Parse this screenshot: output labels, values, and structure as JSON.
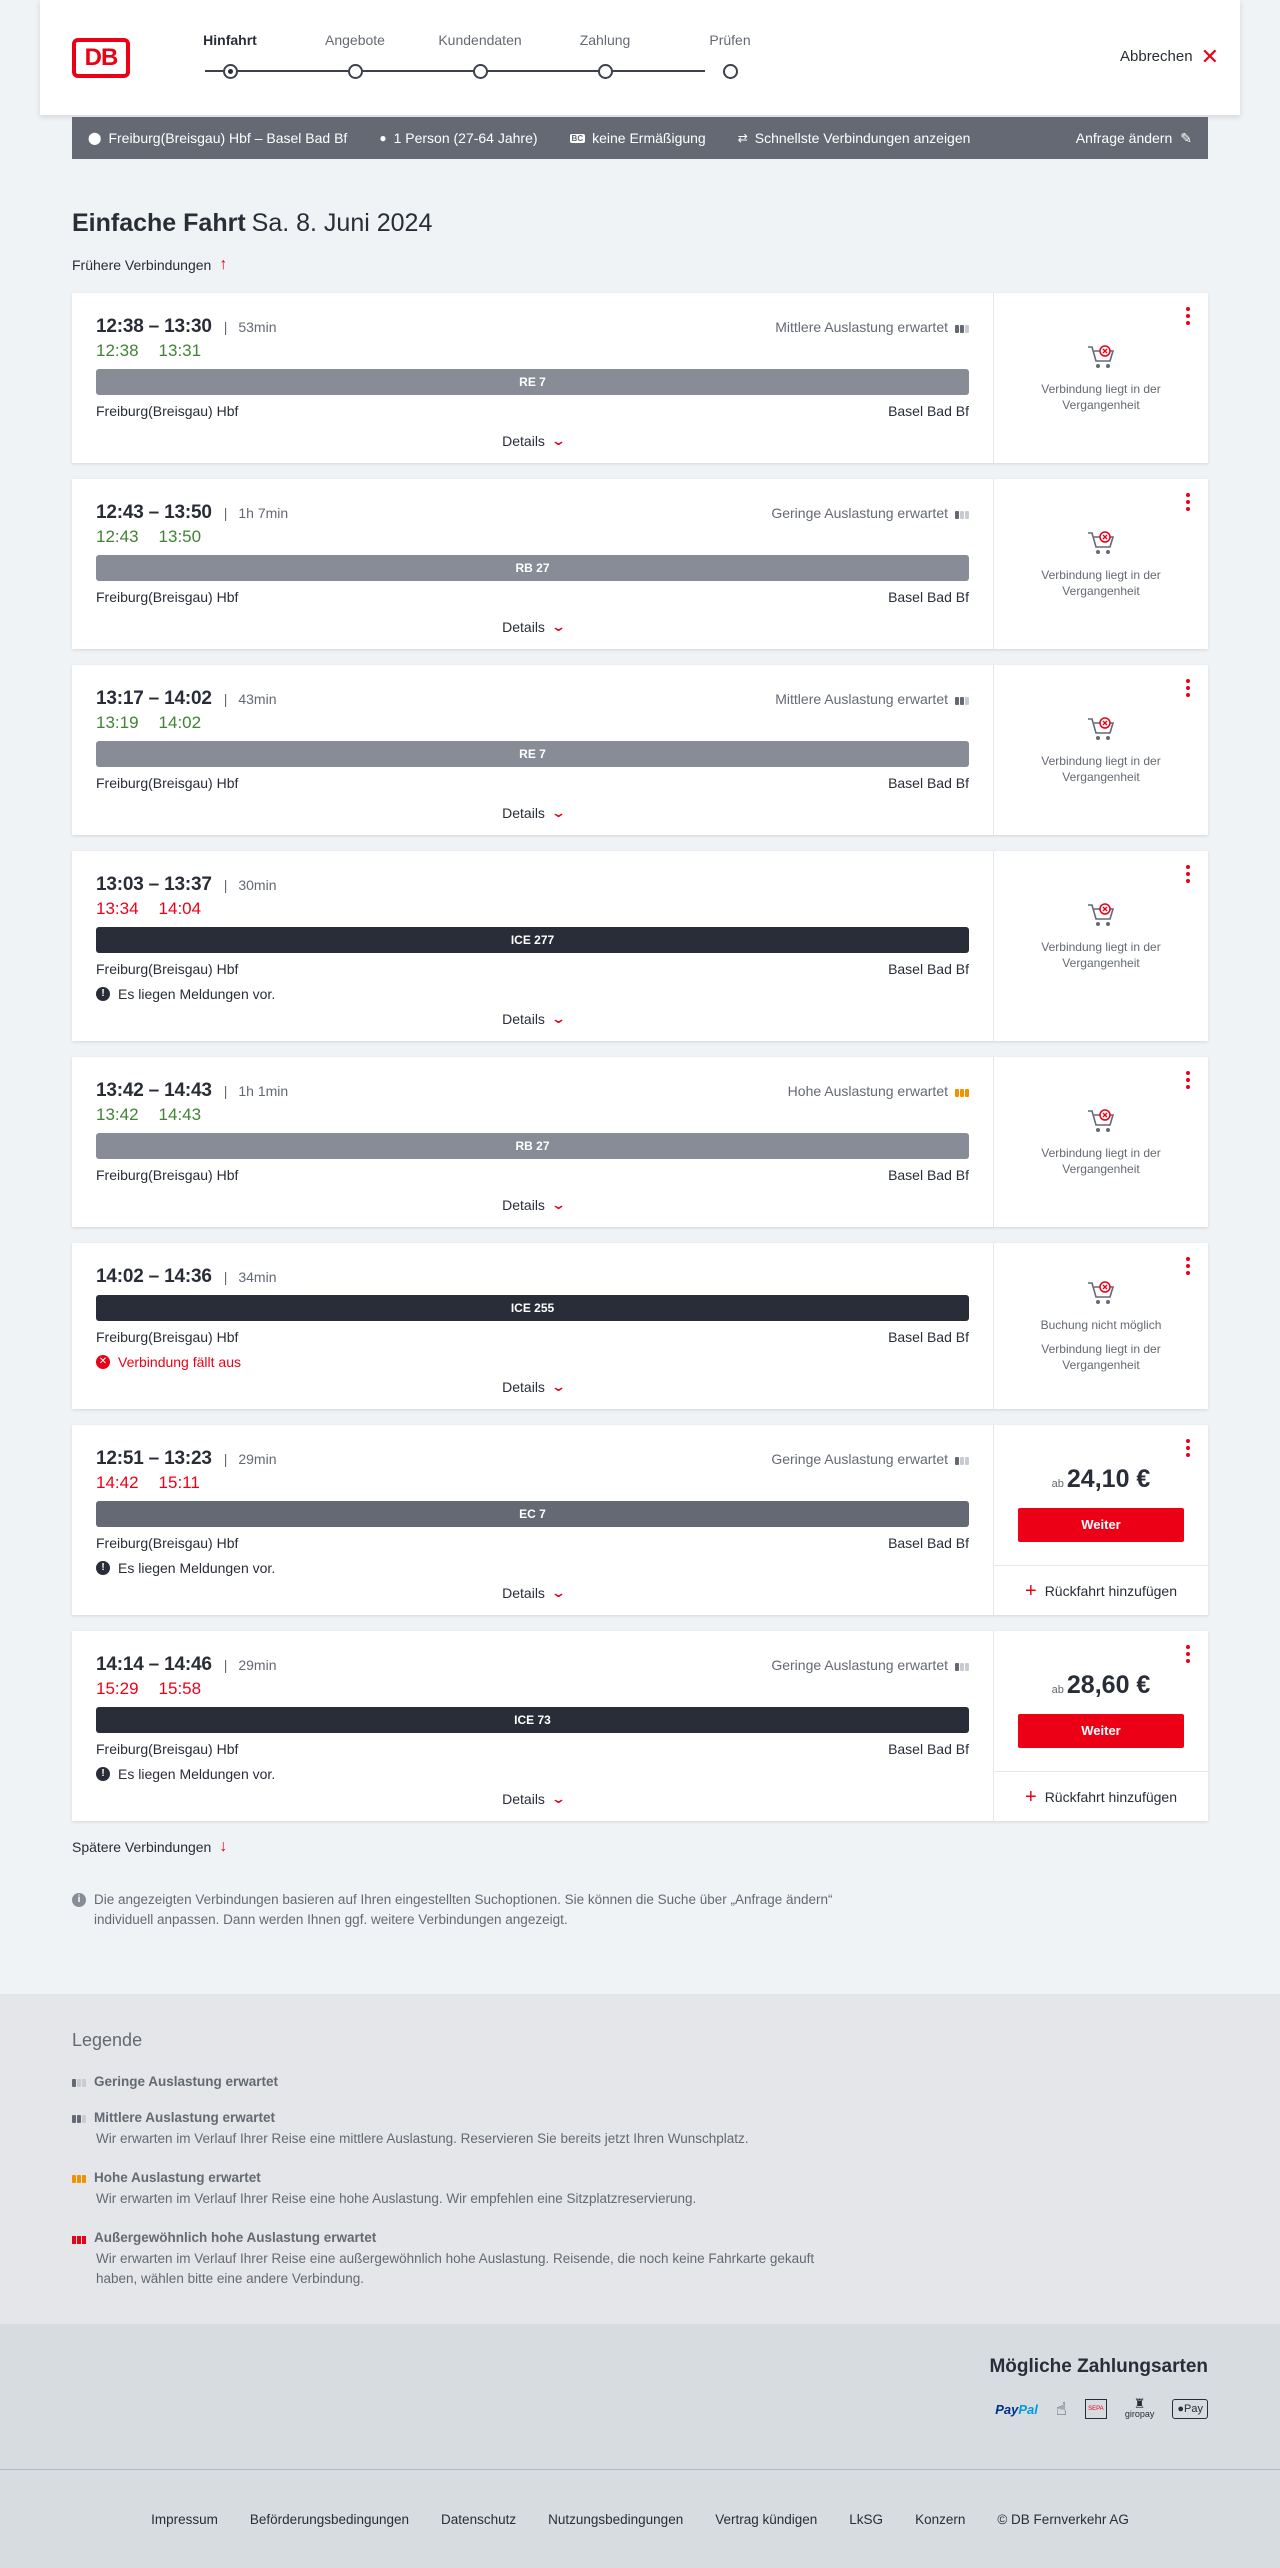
{
  "header": {
    "logo": "DB",
    "steps": [
      {
        "label": "Hinfahrt",
        "active": true
      },
      {
        "label": "Angebote",
        "active": false
      },
      {
        "label": "Kundendaten",
        "active": false
      },
      {
        "label": "Zahlung",
        "active": false
      },
      {
        "label": "Prüfen",
        "active": false
      }
    ],
    "cancel_label": "Abbrechen"
  },
  "search": {
    "route": "Freiburg(Breisgau) Hbf – Basel Bad Bf",
    "passengers": "1 Person (27-64 Jahre)",
    "discount": "keine Ermäßigung",
    "fastest": "Schnellste Verbindungen anzeigen",
    "change": "Anfrage ändern",
    "discount_icon_text": "BC"
  },
  "title": {
    "main": "Einfache Fahrt",
    "date": "Sa. 8. Juni 2024"
  },
  "earlier": "Frühere Verbindungen",
  "later": "Spätere Verbindungen",
  "details_label": "Details",
  "connections": [
    {
      "time": "12:38 – 13:30",
      "duration": "53min",
      "load": "Mittlere Auslastung erwartet",
      "load_level": 2,
      "rt_dep": "12:38",
      "rt_arr": "13:31",
      "rt_color": "green",
      "train": "RE 7",
      "train_kind": "regional",
      "from": "Freiburg(Breisgau) Hbf",
      "to": "Basel Bad Bf",
      "note": "",
      "side": [
        "Verbindung liegt in der Vergangenheit"
      ]
    },
    {
      "time": "12:43 – 13:50",
      "duration": "1h 7min",
      "load": "Geringe Auslastung erwartet",
      "load_level": 1,
      "rt_dep": "12:43",
      "rt_arr": "13:50",
      "rt_color": "green",
      "train": "RB 27",
      "train_kind": "regional",
      "from": "Freiburg(Breisgau) Hbf",
      "to": "Basel Bad Bf",
      "note": "",
      "side": [
        "Verbindung liegt in der Vergangenheit"
      ]
    },
    {
      "time": "13:17 – 14:02",
      "duration": "43min",
      "load": "Mittlere Auslastung erwartet",
      "load_level": 2,
      "rt_dep": "13:19",
      "rt_arr": "14:02",
      "rt_color": "green",
      "train": "RE 7",
      "train_kind": "regional",
      "from": "Freiburg(Breisgau) Hbf",
      "to": "Basel Bad Bf",
      "note": "",
      "side": [
        "Verbindung liegt in der Vergangenheit"
      ]
    },
    {
      "time": "13:03 – 13:37",
      "duration": "30min",
      "load": "",
      "load_level": 0,
      "rt_dep": "13:34",
      "rt_arr": "14:04",
      "rt_color": "red",
      "train": "ICE 277",
      "train_kind": "ic",
      "from": "Freiburg(Breisgau) Hbf",
      "to": "Basel Bad Bf",
      "note": "Es liegen Meldungen vor.",
      "side": [
        "Verbindung liegt in der Vergangenheit"
      ]
    },
    {
      "time": "13:42 – 14:43",
      "duration": "1h 1min",
      "load": "Hohe Auslastung erwartet",
      "load_level": 3,
      "rt_dep": "13:42",
      "rt_arr": "14:43",
      "rt_color": "green",
      "train": "RB 27",
      "train_kind": "regional",
      "from": "Freiburg(Breisgau) Hbf",
      "to": "Basel Bad Bf",
      "note": "",
      "side": [
        "Verbindung liegt in der Vergangenheit"
      ]
    },
    {
      "time": "14:02 – 14:36",
      "duration": "34min",
      "load": "",
      "load_level": 0,
      "rt_dep": "",
      "rt_arr": "",
      "rt_color": "",
      "train": "ICE 255",
      "train_kind": "ic",
      "from": "Freiburg(Breisgau) Hbf",
      "to": "Basel Bad Bf",
      "note": "Verbindung fällt aus",
      "note_kind": "cancel",
      "side": [
        "Buchung nicht möglich",
        "Verbindung liegt in der Vergangenheit"
      ]
    },
    {
      "time": "12:51 – 13:23",
      "duration": "29min",
      "load": "Geringe Auslastung erwartet",
      "load_level": 1,
      "rt_dep": "14:42",
      "rt_arr": "15:11",
      "rt_color": "red",
      "train": "EC 7",
      "train_kind": "ec",
      "from": "Freiburg(Breisgau) Hbf",
      "to": "Basel Bad Bf",
      "note": "Es liegen Meldungen vor.",
      "price_prefix": "ab",
      "price": "24,10 €",
      "button": "Weiter",
      "return": "Rückfahrt hinzufügen"
    },
    {
      "time": "14:14 – 14:46",
      "duration": "29min",
      "load": "Geringe Auslastung erwartet",
      "load_level": 1,
      "rt_dep": "15:29",
      "rt_arr": "15:58",
      "rt_color": "red",
      "train": "ICE 73",
      "train_kind": "ic",
      "from": "Freiburg(Breisgau) Hbf",
      "to": "Basel Bad Bf",
      "note": "Es liegen Meldungen vor.",
      "price_prefix": "ab",
      "price": "28,60 €",
      "button": "Weiter",
      "return": "Rückfahrt hinzufügen"
    }
  ],
  "info": "Die angezeigten Verbindungen basieren auf Ihren eingestellten Suchoptionen. Sie können die Suche über „Anfrage ändern“ individuell anpassen. Dann werden Ihnen ggf. weitere Verbindungen angezeigt.",
  "legend": {
    "title": "Legende",
    "items": [
      {
        "head": "Geringe Auslastung erwartet",
        "desc": ""
      },
      {
        "head": "Mittlere Auslastung erwartet",
        "desc": "Wir erwarten im Verlauf Ihrer Reise eine mittlere Auslastung. Reservieren Sie bereits jetzt Ihren Wunschplatz."
      },
      {
        "head": "Hohe Auslastung erwartet",
        "desc": "Wir erwarten im Verlauf Ihrer Reise eine hohe Auslastung. Wir empfehlen eine Sitzplatzreservierung."
      },
      {
        "head": "Außergewöhnlich hohe Auslastung erwartet",
        "desc": "Wir erwarten im Verlauf Ihrer Reise eine außergewöhnlich hohe Auslastung. Reisende, die noch keine Fahrkarte gekauft haben, wählen bitte eine andere Verbindung."
      }
    ]
  },
  "payment": {
    "title": "Mögliche Zahlungsarten",
    "paypal_a": "Pay",
    "paypal_b": "Pal",
    "sepa": "SEPA",
    "giropay": "giropay",
    "apple": " Pay"
  },
  "footer": [
    "Impressum",
    "Beförderungsbedingungen",
    "Datenschutz",
    "Nutzungsbedingungen",
    "Vertrag kündigen",
    "LkSG",
    "Konzern",
    "© DB Fernverkehr AG"
  ],
  "colors": {
    "accent": "#ec0016",
    "ontime": "#408335",
    "bar_regional": "#878c96",
    "bar_ic": "#282d37",
    "bar_ec": "#646973"
  }
}
